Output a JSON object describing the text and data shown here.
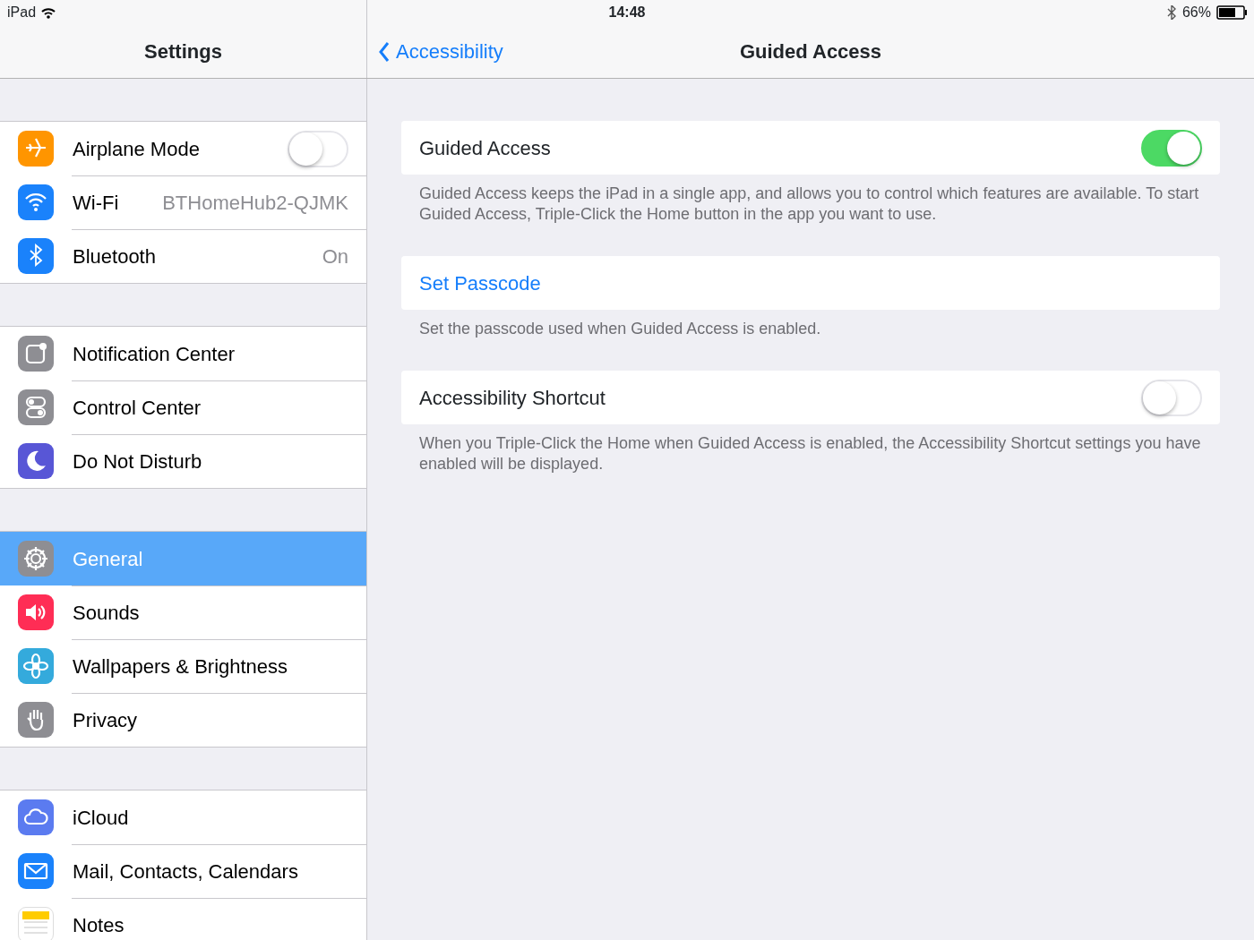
{
  "status_bar": {
    "device": "iPad",
    "time": "14:48",
    "battery": "66%"
  },
  "sidebar": {
    "title": "Settings",
    "groups": [
      [
        {
          "label": "Airplane Mode",
          "kind": "toggle",
          "on": false,
          "selected": false,
          "color": "#ff9500"
        },
        {
          "label": "Wi-Fi",
          "kind": "value",
          "value": "BTHomeHub2-QJMK",
          "selected": false,
          "color": "#1a82fb"
        },
        {
          "label": "Bluetooth",
          "kind": "value",
          "value": "On",
          "selected": false,
          "color": "#1a82fb"
        }
      ],
      [
        {
          "label": "Notification Center",
          "kind": "plain",
          "selected": false,
          "color": "#8e8e93"
        },
        {
          "label": "Control Center",
          "kind": "plain",
          "selected": false,
          "color": "#8e8e93"
        },
        {
          "label": "Do Not Disturb",
          "kind": "plain",
          "selected": false,
          "color": "#5856d6"
        }
      ],
      [
        {
          "label": "General",
          "kind": "plain",
          "selected": true,
          "color": "#8e8e93"
        },
        {
          "label": "Sounds",
          "kind": "plain",
          "selected": false,
          "color": "#ff2d55"
        },
        {
          "label": "Wallpapers & Brightness",
          "kind": "plain",
          "selected": false,
          "color": "#34aadc"
        },
        {
          "label": "Privacy",
          "kind": "plain",
          "selected": false,
          "color": "#8e8e93"
        }
      ],
      [
        {
          "label": "iCloud",
          "kind": "plain",
          "selected": false,
          "color": "#5b7bf0"
        },
        {
          "label": "Mail, Contacts, Calendars",
          "kind": "plain",
          "selected": false,
          "color": "#1a82fb"
        },
        {
          "label": "Notes",
          "kind": "plain",
          "selected": false,
          "color": "#ffcc00"
        }
      ]
    ]
  },
  "detail": {
    "back": "Accessibility",
    "title": "Guided Access",
    "sections": [
      {
        "kind": "toggle",
        "label": "Guided Access",
        "on": true,
        "footer": "Guided Access keeps the iPad in a single app, and allows you to control which features are available. To start Guided Access, Triple-Click the Home button in the app you want to use."
      },
      {
        "kind": "link",
        "label": "Set Passcode",
        "footer": "Set the passcode used when Guided Access is enabled."
      },
      {
        "kind": "toggle",
        "label": "Accessibility Shortcut",
        "on": false,
        "footer": "When you Triple-Click the Home when Guided Access is enabled, the Accessibility Shortcut settings you have enabled will be displayed."
      }
    ]
  }
}
